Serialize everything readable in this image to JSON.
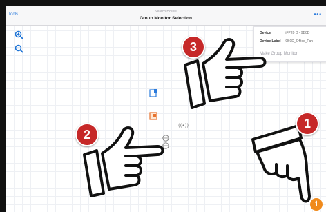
{
  "navbar": {
    "back_label": "Tools",
    "subtitle": "Search House",
    "title": "Group Monitor Selection",
    "more_icon": "ellipsis-icon"
  },
  "zoom": {
    "in_icon": "zoom-in-icon",
    "out_icon": "zoom-out-icon"
  },
  "info_panel": {
    "device_key": "Device",
    "device_value": "iFP20 D - 9B0D",
    "label_key": "Device Label",
    "label_value": "9B0D_Office_Fan",
    "make_group_label": "Make Group Monitor"
  },
  "steps": [
    "1",
    "2",
    "3"
  ],
  "info_button": "i",
  "colors": {
    "accent": "#1e74d6",
    "badge": "#c62828",
    "fab": "#f08a1c"
  }
}
